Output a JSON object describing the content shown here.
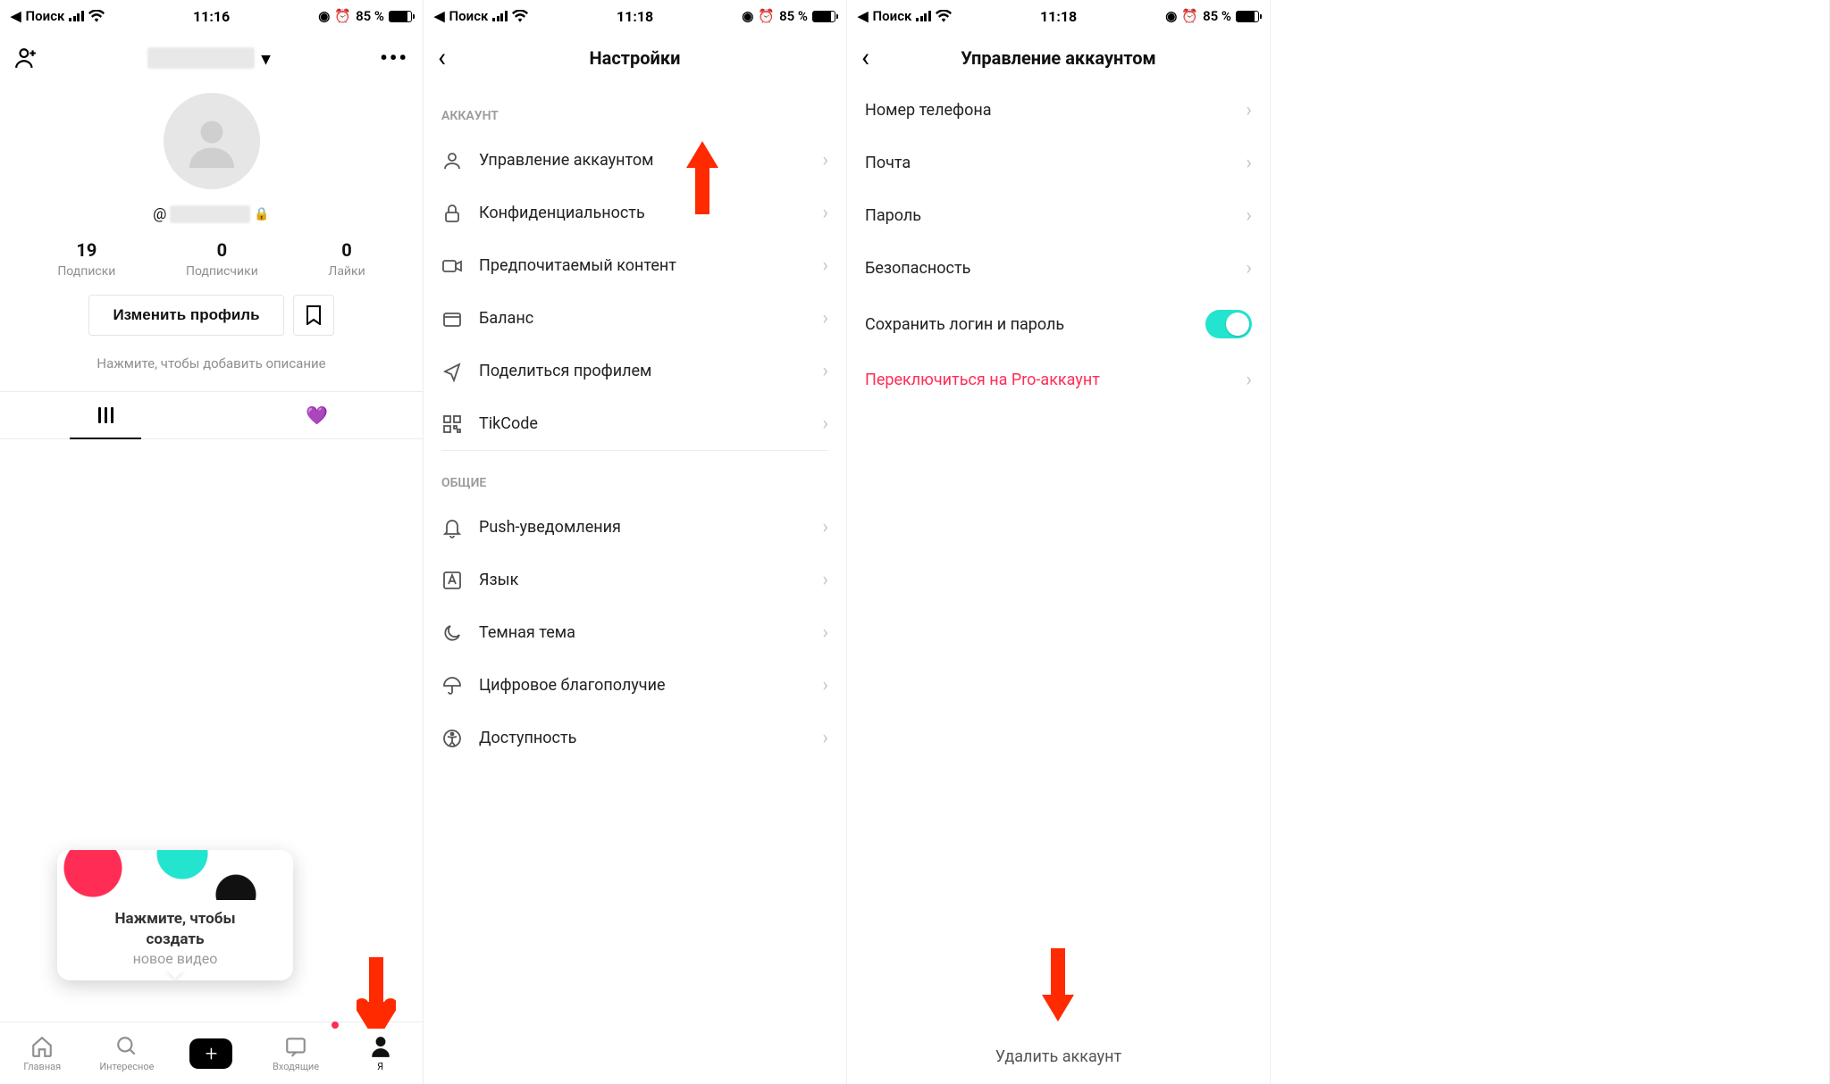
{
  "status": {
    "search": "Поиск",
    "battery": "85 %"
  },
  "panel1": {
    "time": "11:16",
    "username_prefix": "@",
    "stats": {
      "following_num": "19",
      "following_lbl": "Подписки",
      "followers_num": "0",
      "followers_lbl": "Подписчики",
      "likes_num": "0",
      "likes_lbl": "Лайки"
    },
    "edit_btn": "Изменить профиль",
    "bio_hint": "Нажмите, чтобы добавить описание",
    "create_card_line1": "Нажмите, чтобы",
    "create_card_line2": "создать",
    "create_card_line3": "новое видео",
    "nav": {
      "home": "Главная",
      "discover": "Интересное",
      "inbox": "Входящие",
      "profile": "Я"
    }
  },
  "panel2": {
    "time": "11:18",
    "title": "Настройки",
    "section_account": "АККАУНТ",
    "section_general": "ОБЩИЕ",
    "rows": {
      "manage": "Управление аккаунтом",
      "privacy": "Конфиденциальность",
      "content": "Предпочитаемый контент",
      "balance": "Баланс",
      "share": "Поделиться профилем",
      "tikcode": "TikCode",
      "push": "Push-уведомления",
      "lang": "Язык",
      "dark": "Темная тема",
      "wellbeing": "Цифровое благополучие",
      "access": "Доступность"
    }
  },
  "panel3": {
    "time": "11:18",
    "title": "Управление аккаунтом",
    "rows": {
      "phone": "Номер телефона",
      "email": "Почта",
      "password": "Пароль",
      "security": "Безопасность",
      "save_login": "Сохранить логин и пароль",
      "pro": "Переключиться на Pro-аккаунт"
    },
    "delete": "Удалить аккаунт"
  }
}
